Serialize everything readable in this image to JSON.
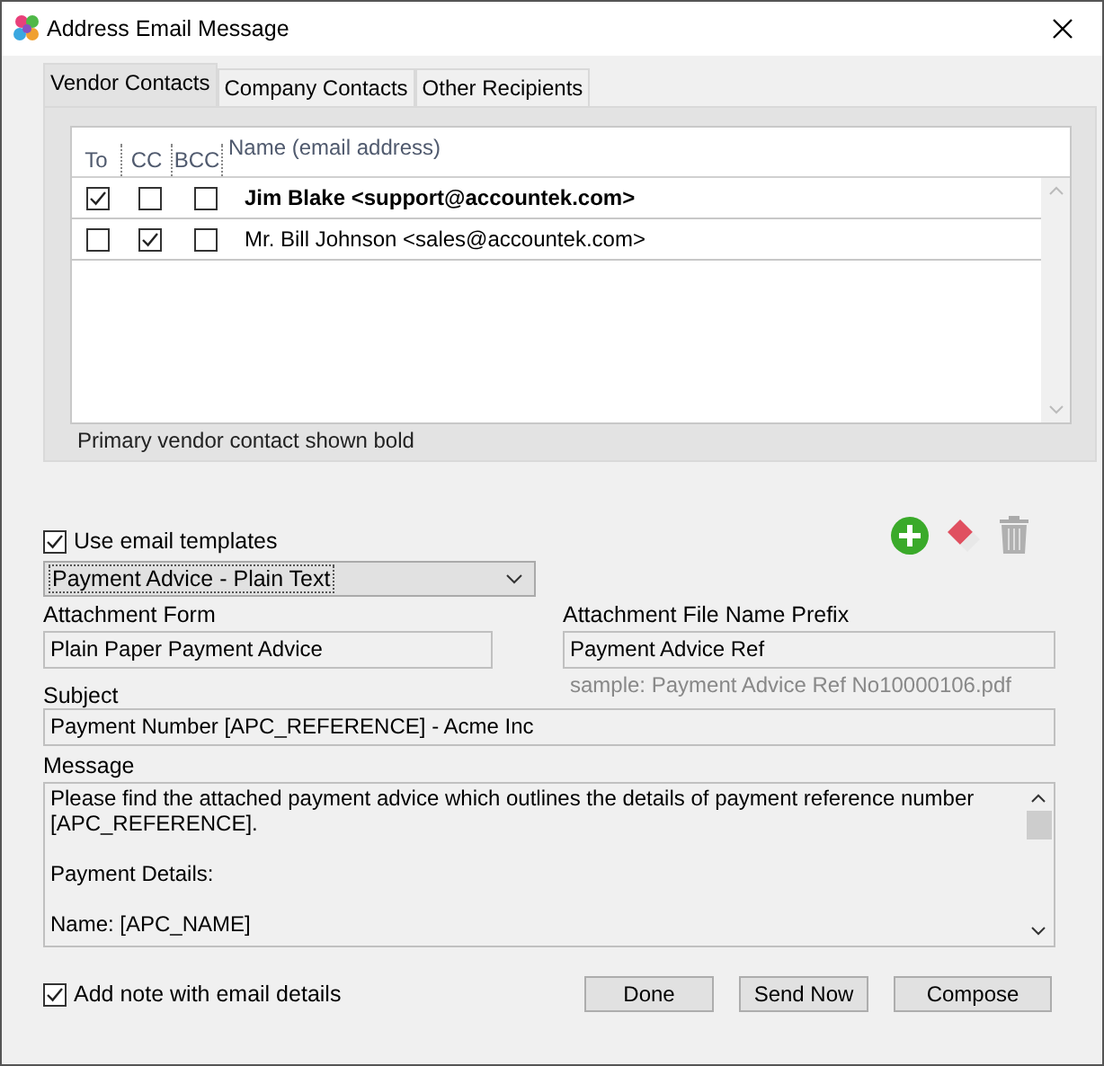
{
  "window": {
    "title": "Address Email Message"
  },
  "tabs": [
    {
      "label": "Vendor Contacts",
      "selected": true
    },
    {
      "label": "Company Contacts",
      "selected": false
    },
    {
      "label": "Other Recipients",
      "selected": false
    }
  ],
  "contacts": {
    "columns": [
      "To",
      "CC",
      "BCC",
      "Name (email address)"
    ],
    "rows": [
      {
        "to": true,
        "cc": false,
        "bcc": false,
        "primary": true,
        "name": "Jim Blake <support@accountek.com>"
      },
      {
        "to": false,
        "cc": true,
        "bcc": false,
        "primary": false,
        "name": "Mr. Bill Johnson <sales@accountek.com>"
      }
    ],
    "note": "Primary vendor contact shown bold"
  },
  "use_templates": {
    "label": "Use email templates",
    "checked": true
  },
  "template": {
    "value": "Payment Advice - Plain Text"
  },
  "attachment_form": {
    "label": "Attachment Form",
    "value": "Plain Paper Payment Advice"
  },
  "prefix": {
    "label": "Attachment File Name Prefix",
    "value": "Payment Advice Ref",
    "sample": "sample: Payment Advice Ref No10000106.pdf"
  },
  "subject": {
    "label": "Subject",
    "value": "Payment Number [APC_REFERENCE] - Acme Inc"
  },
  "message": {
    "label": "Message",
    "paragraphs": [
      "Please find the attached payment advice which outlines the details of payment reference number [APC_REFERENCE].",
      "Payment Details:",
      "Name: [APC_NAME]"
    ]
  },
  "add_note": {
    "label": "Add note with email details",
    "checked": true
  },
  "buttons": [
    "Done",
    "Send Now",
    "Compose"
  ]
}
